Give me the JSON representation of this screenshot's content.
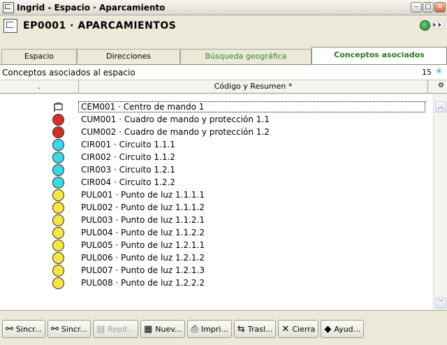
{
  "window": {
    "title": "Ingrid - Espacio · Aparcamiento"
  },
  "header": {
    "title": "EP0001 · APARCAMIENTOS"
  },
  "tabs": [
    {
      "label": "Espacio"
    },
    {
      "label": "Direcciones"
    },
    {
      "label": "Búsqueda geográfica"
    },
    {
      "label": "Conceptos asociados"
    }
  ],
  "panel": {
    "label": "Conceptos asociados al espacio",
    "count": "15"
  },
  "columns": {
    "c1": ".",
    "c2": "Código y Resumen *"
  },
  "rows": [
    {
      "text": "CEM001 · Centro de mando 1",
      "kind": "flag"
    },
    {
      "text": "CUM001 · Cuadro de mando y protección 1.1",
      "kind": "red"
    },
    {
      "text": "CUM002 · Cuadro de mando y protección 1.2",
      "kind": "red"
    },
    {
      "text": "CIR001 · Circuito 1.1.1",
      "kind": "cyan"
    },
    {
      "text": "CIR002 · Circuito 1.1.2",
      "kind": "cyan"
    },
    {
      "text": "CIR003 · Circuito 1.2.1",
      "kind": "cyan"
    },
    {
      "text": "CIR004 · Circuito 1.2.2",
      "kind": "cyan"
    },
    {
      "text": "PUL001 · Punto de luz 1.1.1.1",
      "kind": "yellow"
    },
    {
      "text": "PUL002 · Punto de luz 1.1.1.2",
      "kind": "yellow"
    },
    {
      "text": "PUL003 · Punto de luz 1.1.2.1",
      "kind": "yellow"
    },
    {
      "text": "PUL004 · Punto de luz 1.1.2.2",
      "kind": "yellow"
    },
    {
      "text": "PUL005 · Punto de luz 1.2.1.1",
      "kind": "yellow"
    },
    {
      "text": "PUL006 · Punto de luz 1.2.1.2",
      "kind": "yellow"
    },
    {
      "text": "PUL007 · Punto de luz 1.2.1.3",
      "kind": "yellow"
    },
    {
      "text": "PUL008 · Punto de luz 1.2.2.2",
      "kind": "yellow"
    }
  ],
  "toolbar": [
    {
      "label": "Sincr...",
      "icon": "⚯",
      "name": "sync-button-1",
      "disabled": false
    },
    {
      "label": "Sincr...",
      "icon": "⚯",
      "name": "sync-button-2",
      "disabled": false
    },
    {
      "label": "Repit...",
      "icon": "▤",
      "name": "repeat-button",
      "disabled": true
    },
    {
      "label": "Nuev...",
      "icon": "▦",
      "name": "new-button",
      "disabled": false
    },
    {
      "label": "Impri...",
      "icon": "⎙",
      "name": "print-button",
      "disabled": false
    },
    {
      "label": "Trasl...",
      "icon": "⇆",
      "name": "transfer-button",
      "disabled": false
    },
    {
      "label": "Cierra",
      "icon": "✕",
      "name": "close-button",
      "disabled": false
    },
    {
      "label": "Ayud...",
      "icon": "◆",
      "name": "help-button",
      "disabled": false
    }
  ],
  "colors": {
    "tab_active": "#2a7a1a",
    "dot_red": "#e23a2a",
    "dot_cyan": "#38d8e4",
    "dot_yellow": "#f8e640"
  }
}
